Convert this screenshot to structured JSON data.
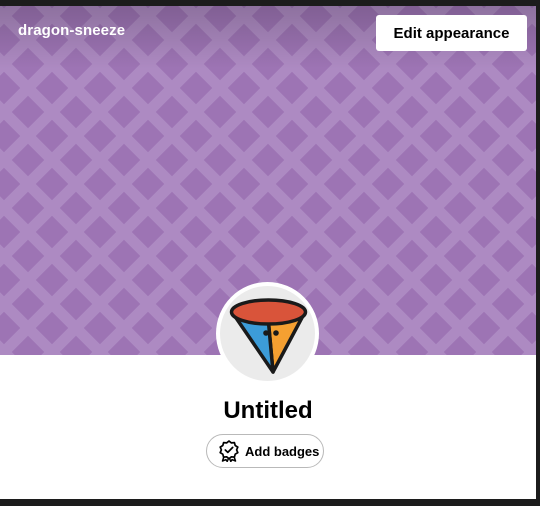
{
  "header": {
    "blog_name": "dragon-sneeze",
    "edit_button_label": "Edit appearance",
    "background_color": "#9d74b4",
    "pattern_color": "#ad8ac2"
  },
  "avatar": {
    "icon": "cone-creature-icon",
    "colors": {
      "top": "#d9543a",
      "left": "#3c9cd8",
      "right": "#f5a031",
      "outline": "#1a1a1a"
    }
  },
  "profile": {
    "title": "Untitled",
    "add_badges_label": "Add badges",
    "add_badges_icon": "badge-ribbon-icon"
  }
}
